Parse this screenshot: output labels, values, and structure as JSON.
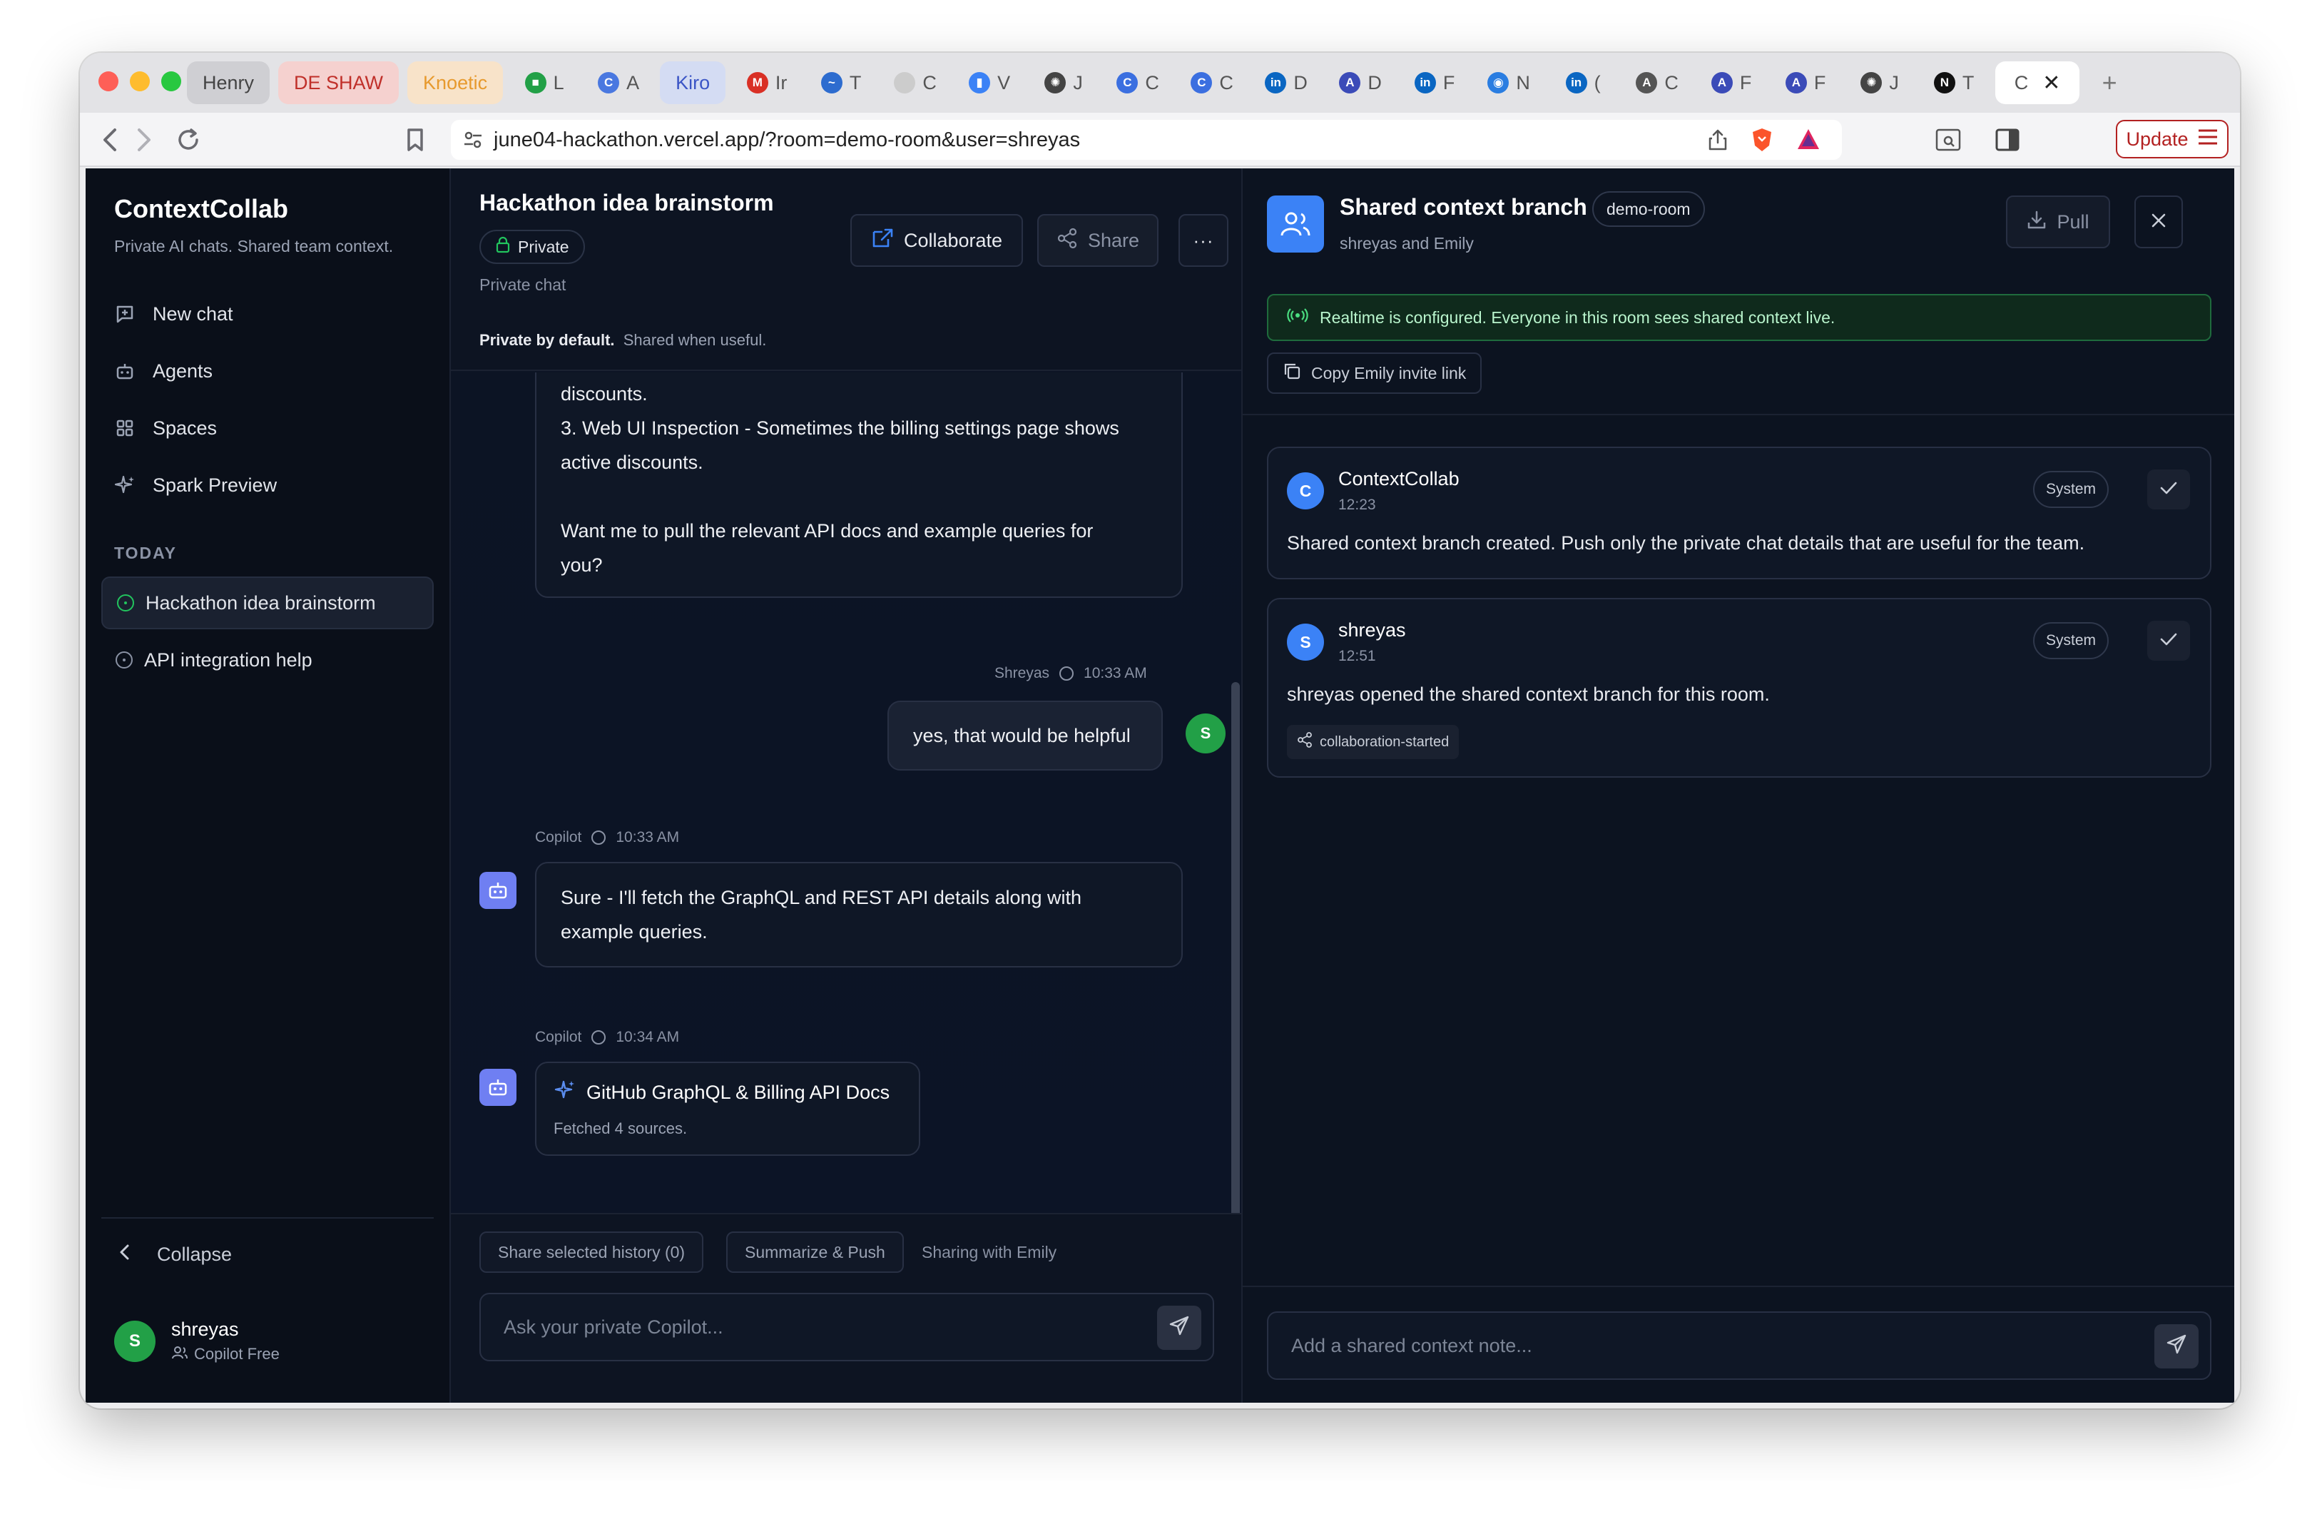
{
  "browser": {
    "tabs": [
      {
        "label": "Henry",
        "bg": "#cfcfd3",
        "color": "#444"
      },
      {
        "label": "DE SHAW",
        "bg": "#f5d1cf",
        "color": "#c0302a"
      },
      {
        "label": "Knoetic",
        "bg": "#f8e3c9",
        "color": "#e79a2e"
      },
      {
        "label": "L",
        "icon": "■",
        "icon_color": "#22a047"
      },
      {
        "label": "A",
        "icon": "C",
        "icon_color": "#4a78e0"
      },
      {
        "label": "Kiro",
        "bg": "#d4dcf3",
        "color": "#3b55c6"
      },
      {
        "label": "Ir",
        "icon": "M",
        "icon_color": "#d93025"
      },
      {
        "label": "T",
        "icon": "~",
        "icon_color": "#2d6ccf"
      },
      {
        "label": "C",
        "icon": "",
        "icon_color": "#cccccc"
      },
      {
        "label": "V",
        "icon": "▮",
        "icon_color": "#3b82f6"
      },
      {
        "label": "J",
        "icon": "✺",
        "icon_color": "#444444"
      },
      {
        "label": "C",
        "icon": "C",
        "icon_color": "#3b6fe0"
      },
      {
        "label": "C",
        "icon": "C",
        "icon_color": "#3b6fe0"
      },
      {
        "label": "D",
        "icon": "in",
        "icon_color": "#0a66c2"
      },
      {
        "label": "D",
        "icon": "A",
        "icon_color": "#3b4bb8"
      },
      {
        "label": "F",
        "icon": "in",
        "icon_color": "#0a66c2"
      },
      {
        "label": "N",
        "icon": "◉",
        "icon_color": "#2a7de1"
      },
      {
        "label": "(",
        "icon": "in",
        "icon_color": "#0a66c2"
      },
      {
        "label": "C",
        "icon": "A",
        "icon_color": "#555555"
      },
      {
        "label": "F",
        "icon": "A",
        "icon_color": "#3b4bb8"
      },
      {
        "label": "F",
        "icon": "A",
        "icon_color": "#3b4bb8"
      },
      {
        "label": "J",
        "icon": "✺",
        "icon_color": "#444444"
      },
      {
        "label": "T",
        "icon": "N",
        "icon_color": "#111111"
      },
      {
        "label": "C",
        "active": true
      }
    ],
    "url": "june04-hackathon.vercel.app/?room=demo-room&user=shreyas",
    "update_label": "Update"
  },
  "sidebar": {
    "brand": "ContextCollab",
    "tagline": "Private AI chats. Shared team context.",
    "nav": [
      {
        "label": "New chat",
        "icon": "new-chat-icon"
      },
      {
        "label": "Agents",
        "icon": "bot-icon"
      },
      {
        "label": "Spaces",
        "icon": "grid-icon"
      },
      {
        "label": "Spark Preview",
        "icon": "sparkle-icon"
      }
    ],
    "section_label": "TODAY",
    "chats": [
      {
        "label": "Hackathon idea brainstorm",
        "active": true
      },
      {
        "label": "API integration help",
        "active": false
      }
    ],
    "collapse_label": "Collapse",
    "user": {
      "initial": "S",
      "name": "shreyas",
      "plan": "Copilot Free"
    }
  },
  "chat": {
    "title": "Hackathon idea brainstorm",
    "private_badge": "Private",
    "subtitle": "Private chat",
    "collaborate_label": "Collaborate",
    "share_label": "Share",
    "more_label": "···",
    "privacy_bold": "Private by default.",
    "privacy_rest": "Shared when useful.",
    "messages": {
      "partial_lines": [
        "discounts.",
        "3. Web UI Inspection - Sometimes the billing settings page shows",
        "active discounts.",
        "",
        "Want me to pull the relevant API docs and example queries for",
        "you?"
      ],
      "user_msg": {
        "author": "Shreyas",
        "time": "10:33 AM",
        "text": "yes, that would be helpful",
        "initial": "S"
      },
      "copilot_msg": {
        "author": "Copilot",
        "time": "10:33 AM",
        "lines": [
          "Sure - I'll fetch the GraphQL and REST API details along with",
          "example queries."
        ]
      },
      "copilot_tool": {
        "author": "Copilot",
        "time": "10:34 AM",
        "title": "GitHub GraphQL & Billing API Docs",
        "subtitle": "Fetched 4 sources."
      }
    },
    "footer": {
      "share_history_label": "Share selected history (0)",
      "summarize_label": "Summarize & Push",
      "sharing_with": "Sharing with Emily",
      "composer_placeholder": "Ask your private Copilot..."
    }
  },
  "panel": {
    "title": "Shared context branch",
    "room_badge": "demo-room",
    "subtitle": "shreyas and Emily",
    "pull_label": "Pull",
    "realtime_text": "Realtime is configured. Everyone in this room sees shared context live.",
    "invite_label": "Copy Emily invite link",
    "entries": [
      {
        "initial": "C",
        "name": "ContextCollab",
        "time": "12:23",
        "badge": "System",
        "text": "Shared context branch created. Push only the private chat details that are useful for the team."
      },
      {
        "initial": "S",
        "name": "shreyas",
        "time": "12:51",
        "badge": "System",
        "text": "shreyas opened the shared context branch for this room.",
        "tag": "collaboration-started"
      }
    ],
    "note_placeholder": "Add a shared context note..."
  }
}
